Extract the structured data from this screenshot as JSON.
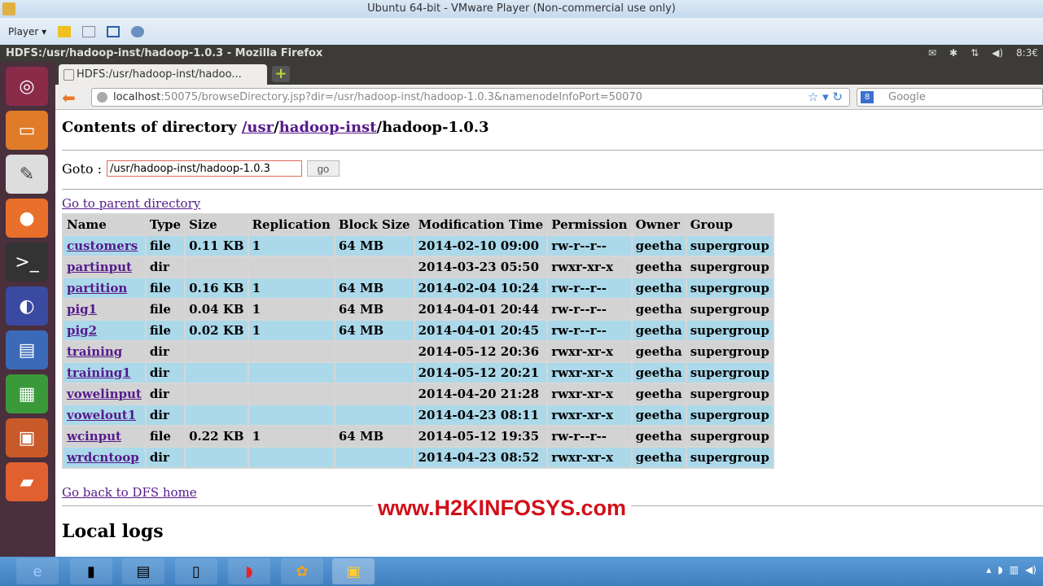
{
  "vm": {
    "title": "Ubuntu 64-bit - VMware Player (Non-commercial use only)",
    "player_menu": "Player ▾"
  },
  "ubuntu": {
    "window_title": "HDFS:/usr/hadoop-inst/hadoop-1.0.3 - Mozilla Firefox",
    "clock": "8:3€"
  },
  "browser": {
    "tab_title": "HDFS:/usr/hadoop-inst/hadoo...",
    "new_tab": "+",
    "url_host": "localhost",
    "url_rest": ":50075/browseDirectory.jsp?dir=/usr/hadoop-inst/hadoop-1.0.3&namenodeInfoPort=50070",
    "search_placeholder": "Google"
  },
  "page": {
    "heading_prefix": "Contents of directory ",
    "crumb_usr": "/usr",
    "crumb_sep": "/",
    "crumb_inst": "hadoop-inst",
    "crumb_current": "/hadoop-1.0.3",
    "goto_label": "Goto :",
    "goto_value": "/usr/hadoop-inst/hadoop-1.0.3",
    "go_button": "go",
    "parent_link": "Go to parent directory",
    "columns": [
      "Name",
      "Type",
      "Size",
      "Replication",
      "Block Size",
      "Modification Time",
      "Permission",
      "Owner",
      "Group"
    ],
    "rows": [
      [
        "customers",
        "file",
        "0.11 KB",
        "1",
        "64 MB",
        "2014-02-10 09:00",
        "rw-r--r--",
        "geetha",
        "supergroup"
      ],
      [
        "partinput",
        "dir",
        "",
        "",
        "",
        "2014-03-23 05:50",
        "rwxr-xr-x",
        "geetha",
        "supergroup"
      ],
      [
        "partition",
        "file",
        "0.16 KB",
        "1",
        "64 MB",
        "2014-02-04 10:24",
        "rw-r--r--",
        "geetha",
        "supergroup"
      ],
      [
        "pig1",
        "file",
        "0.04 KB",
        "1",
        "64 MB",
        "2014-04-01 20:44",
        "rw-r--r--",
        "geetha",
        "supergroup"
      ],
      [
        "pig2",
        "file",
        "0.02 KB",
        "1",
        "64 MB",
        "2014-04-01 20:45",
        "rw-r--r--",
        "geetha",
        "supergroup"
      ],
      [
        "training",
        "dir",
        "",
        "",
        "",
        "2014-05-12 20:36",
        "rwxr-xr-x",
        "geetha",
        "supergroup"
      ],
      [
        "training1",
        "dir",
        "",
        "",
        "",
        "2014-05-12 20:21",
        "rwxr-xr-x",
        "geetha",
        "supergroup"
      ],
      [
        "vowelinput",
        "dir",
        "",
        "",
        "",
        "2014-04-20 21:28",
        "rwxr-xr-x",
        "geetha",
        "supergroup"
      ],
      [
        "vowelout1",
        "dir",
        "",
        "",
        "",
        "2014-04-23 08:11",
        "rwxr-xr-x",
        "geetha",
        "supergroup"
      ],
      [
        "wcinput",
        "file",
        "0.22 KB",
        "1",
        "64 MB",
        "2014-05-12 19:35",
        "rw-r--r--",
        "geetha",
        "supergroup"
      ],
      [
        "wrdcntoop",
        "dir",
        "",
        "",
        "",
        "2014-04-23 08:52",
        "rwxr-xr-x",
        "geetha",
        "supergroup"
      ]
    ],
    "dfs_home": "Go back to DFS home",
    "local_logs": "Local logs"
  },
  "watermark": "www.H2KINFOSYS.com"
}
